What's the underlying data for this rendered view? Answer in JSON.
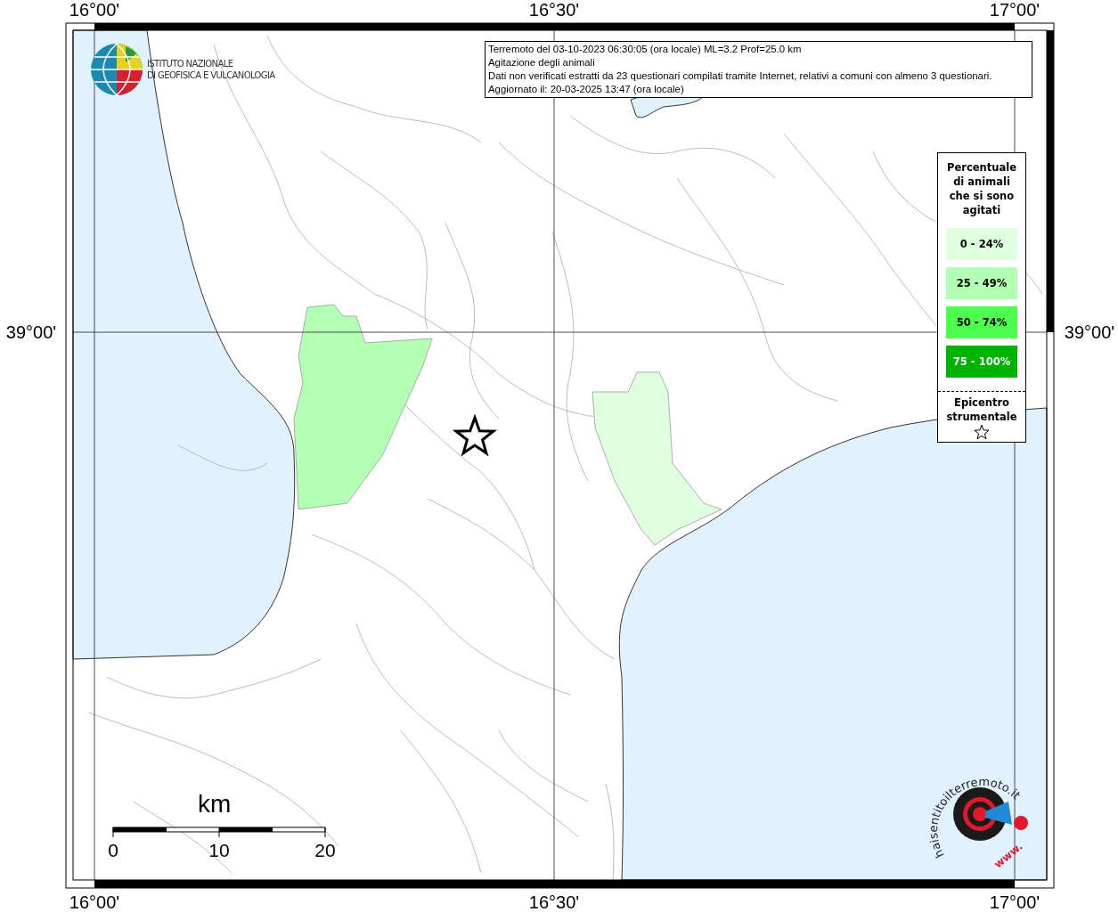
{
  "axes": {
    "top": [
      "16°00'",
      "16°30'",
      "17°00'"
    ],
    "bottom": [
      "16°00'",
      "16°30'",
      "17°00'"
    ],
    "left": [
      "39°00'"
    ],
    "right": [
      "39°00'"
    ]
  },
  "logo": {
    "lines": [
      "ISTITUTO NAZIONALE",
      "DI GEOFISICA E VULCANOLOGIA"
    ]
  },
  "info_box": {
    "lines": [
      "Terremoto del 03-10-2023 06:30:05 (ora locale) ML=3.2 Prof=25.0 km",
      "Agitazione degli animali",
      "Dati non verificati estratti da 23 questionari compilati tramite Internet, relativi a comuni con almeno 3 questionari.",
      "Aggiornato il: 20-03-2025 13:47 (ora locale)"
    ]
  },
  "legend": {
    "title": "Percentuale di animali che si sono agitati",
    "items": [
      {
        "label": "0 - 24%",
        "color": "#dfffdf"
      },
      {
        "label": "25 - 49%",
        "color": "#b3ffb3"
      },
      {
        "label": "50 - 74%",
        "color": "#4dff4d"
      },
      {
        "label": "75 - 100%",
        "color": "#00b300"
      }
    ],
    "epicenter_label": "Epicentro strumentale"
  },
  "municipalities": [
    {
      "color": "#b3ffb3"
    },
    {
      "color": "#dfffdf"
    }
  ],
  "scale": {
    "unit": "km",
    "ticks": [
      "0",
      "10",
      "20"
    ]
  },
  "site_logo": {
    "arc_text": "haisentitoilterremoto.it",
    "prefix": "www."
  }
}
